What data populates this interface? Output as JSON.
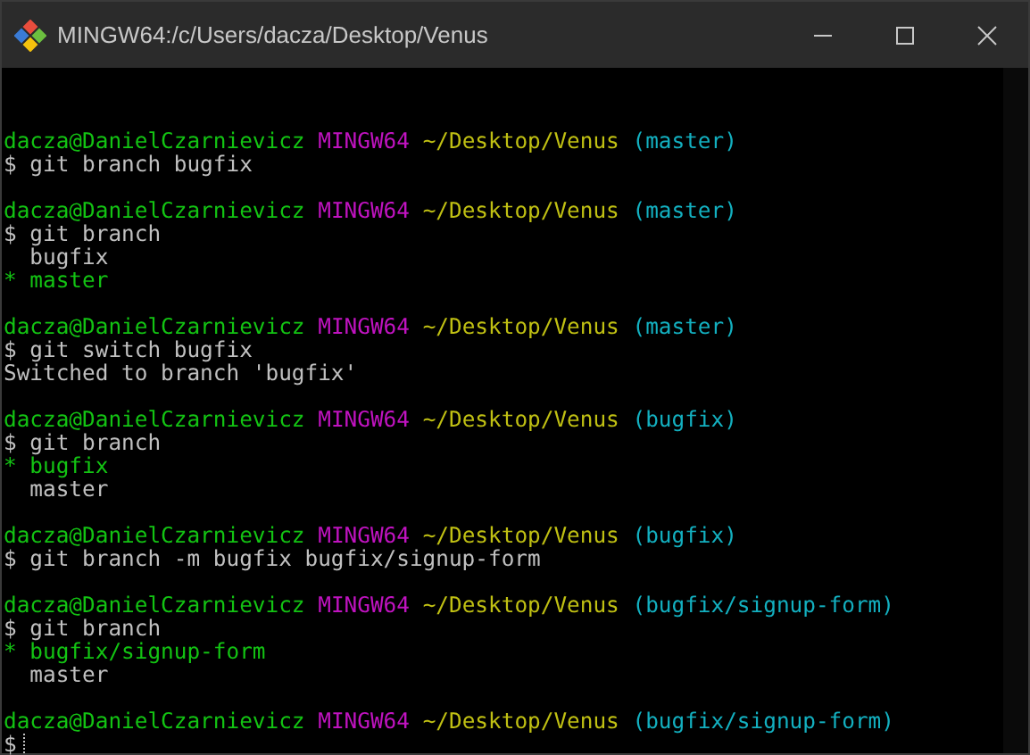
{
  "window": {
    "title": "MINGW64:/c/Users/dacza/Desktop/Venus"
  },
  "terminal": {
    "lines": [
      {
        "kind": "prompt",
        "user": "dacza@DanielCzarnievicz",
        "system": "MINGW64",
        "path": "~/Desktop/Venus",
        "branch": "(master)"
      },
      {
        "kind": "command",
        "text": "$ git branch bugfix"
      },
      {
        "kind": "blank"
      },
      {
        "kind": "prompt",
        "user": "dacza@DanielCzarnievicz",
        "system": "MINGW64",
        "path": "~/Desktop/Venus",
        "branch": "(master)"
      },
      {
        "kind": "command",
        "text": "$ git branch"
      },
      {
        "kind": "branch",
        "name": "bugfix",
        "selected": false
      },
      {
        "kind": "branch",
        "marker": "*",
        "name": "master",
        "selected": true
      },
      {
        "kind": "blank"
      },
      {
        "kind": "prompt",
        "user": "dacza@DanielCzarnievicz",
        "system": "MINGW64",
        "path": "~/Desktop/Venus",
        "branch": "(master)"
      },
      {
        "kind": "command",
        "text": "$ git switch bugfix"
      },
      {
        "kind": "output",
        "text": "Switched to branch 'bugfix'"
      },
      {
        "kind": "blank"
      },
      {
        "kind": "prompt",
        "user": "dacza@DanielCzarnievicz",
        "system": "MINGW64",
        "path": "~/Desktop/Venus",
        "branch": "(bugfix)"
      },
      {
        "kind": "command",
        "text": "$ git branch"
      },
      {
        "kind": "branch",
        "marker": "*",
        "name": "bugfix",
        "selected": true
      },
      {
        "kind": "branch",
        "name": "master",
        "selected": false
      },
      {
        "kind": "blank"
      },
      {
        "kind": "prompt",
        "user": "dacza@DanielCzarnievicz",
        "system": "MINGW64",
        "path": "~/Desktop/Venus",
        "branch": "(bugfix)"
      },
      {
        "kind": "command",
        "text": "$ git branch -m bugfix bugfix/signup-form"
      },
      {
        "kind": "blank"
      },
      {
        "kind": "prompt",
        "user": "dacza@DanielCzarnievicz",
        "system": "MINGW64",
        "path": "~/Desktop/Venus",
        "branch": "(bugfix/signup-form)"
      },
      {
        "kind": "command",
        "text": "$ git branch"
      },
      {
        "kind": "branch",
        "marker": "*",
        "name": "bugfix/signup-form",
        "selected": true
      },
      {
        "kind": "branch",
        "name": "master",
        "selected": false
      },
      {
        "kind": "blank"
      },
      {
        "kind": "prompt",
        "user": "dacza@DanielCzarnievicz",
        "system": "MINGW64",
        "path": "~/Desktop/Venus",
        "branch": "(bugfix/signup-form)"
      },
      {
        "kind": "input",
        "text": "$"
      }
    ]
  }
}
